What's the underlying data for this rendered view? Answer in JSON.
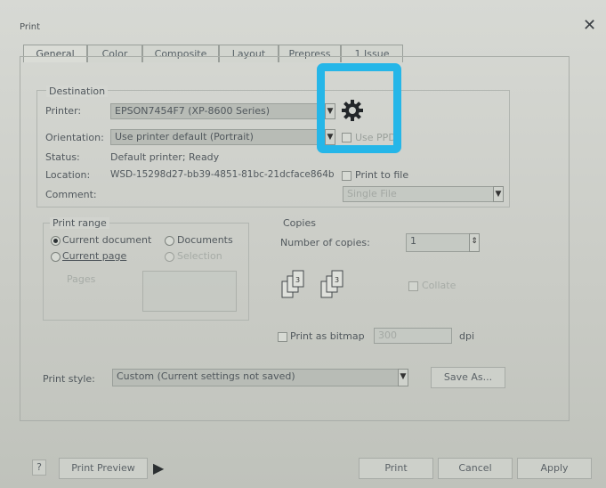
{
  "window": {
    "title": "Print",
    "close_glyph": "✕"
  },
  "tabs": [
    "General",
    "Color",
    "Composite",
    "Layout",
    "Prepress",
    "1 Issue"
  ],
  "destination": {
    "group_label": "Destination",
    "printer_label": "Printer:",
    "printer_value": "EPSON7454F7 (XP-8600 Series)",
    "orientation_label": "Orientation:",
    "orientation_value": "Use printer default (Portrait)",
    "use_ppd_label": "Use PPD",
    "status_label": "Status:",
    "status_value": "Default printer; Ready",
    "location_label": "Location:",
    "location_value": "WSD-15298d27-bb39-4851-81bc-21dcface864b",
    "print_to_file_label": "Print to file",
    "comment_label": "Comment:",
    "file_option_value": "Single File"
  },
  "print_range": {
    "group_label": "Print range",
    "current_document": "Current document",
    "documents": "Documents",
    "current_page": "Current page",
    "selection": "Selection",
    "pages": "Pages"
  },
  "copies": {
    "group_label": "Copies",
    "number_label": "Number of copies:",
    "number_value": "1",
    "collate_label": "Collate"
  },
  "bitmap": {
    "label": "Print as bitmap",
    "dpi_value": "300",
    "dpi_unit": "dpi"
  },
  "print_style": {
    "label": "Print style:",
    "value": "Custom (Current settings not saved)",
    "save_as": "Save As..."
  },
  "bottom": {
    "print_preview": "Print Preview",
    "print": "Print",
    "cancel": "Cancel",
    "apply": "Apply"
  },
  "colors": {
    "highlight": "#25b6e8"
  },
  "icons": {
    "printer_properties": "gear-icon",
    "dropdown": "chevron-down-icon",
    "preview_arrow": "play-icon"
  }
}
